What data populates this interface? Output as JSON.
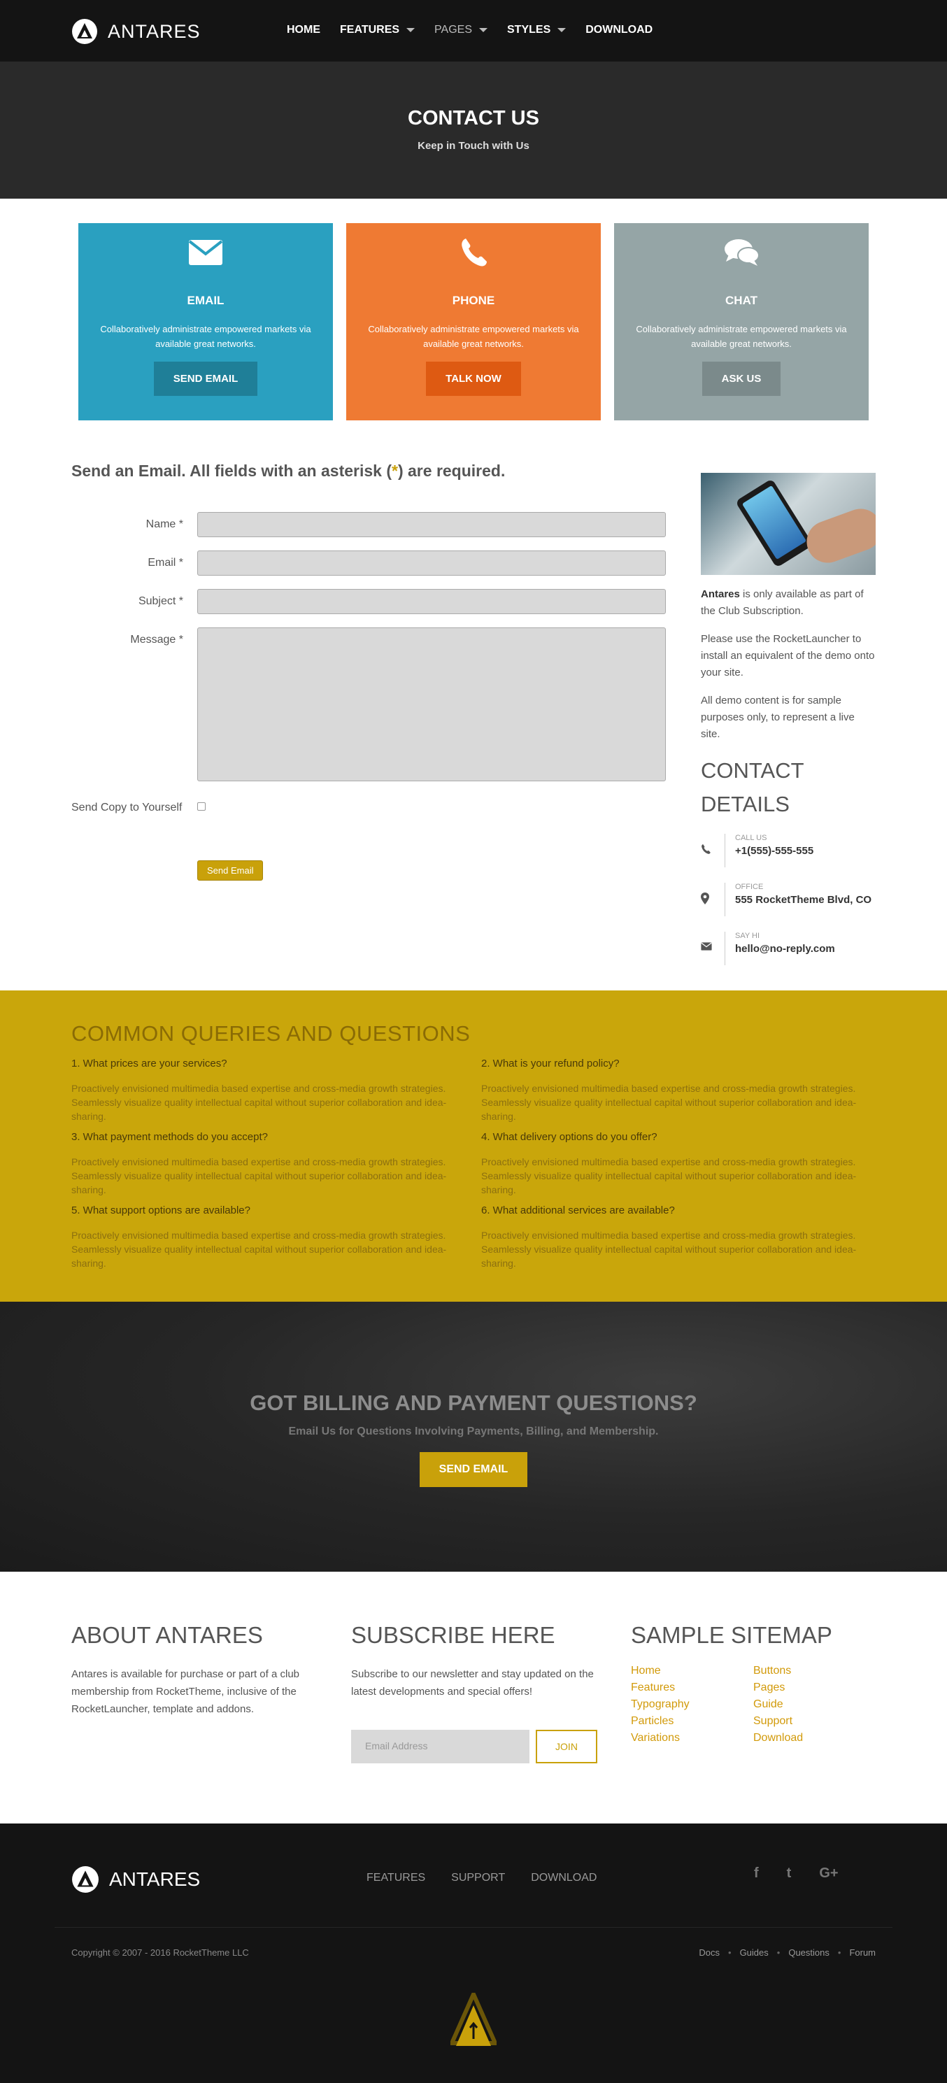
{
  "header": {
    "brand": "ANTARES",
    "nav": [
      {
        "label": "HOME",
        "dropdown": false
      },
      {
        "label": "FEATURES",
        "dropdown": true
      },
      {
        "label": "PAGES",
        "dropdown": true
      },
      {
        "label": "STYLES",
        "dropdown": true
      },
      {
        "label": "DOWNLOAD",
        "dropdown": false
      }
    ]
  },
  "title": {
    "heading": "CONTACT US",
    "subheading": "Keep in Touch with Us"
  },
  "cards": [
    {
      "icon": "envelope-icon",
      "title": "EMAIL",
      "text": "Collaboratively administrate empowered markets via available great networks.",
      "button": "SEND EMAIL",
      "color": "#2aa0c0",
      "button_color": "#1f7f98"
    },
    {
      "icon": "phone-icon",
      "title": "PHONE",
      "text": "Collaboratively administrate empowered markets via available great networks.",
      "button": "TALK NOW",
      "color": "#ef7a33",
      "button_color": "#de5a12"
    },
    {
      "icon": "chat-icon",
      "title": "CHAT",
      "text": "Collaboratively administrate empowered markets via available great networks.",
      "button": "ASK US",
      "color": "#95a5a6",
      "button_color": "#7b8a8b"
    }
  ],
  "form": {
    "heading_pre": "Send an Email. All fields with an asterisk (",
    "heading_star": "*",
    "heading_post": ") are required.",
    "name_label": "Name *",
    "email_label": "Email *",
    "subject_label": "Subject *",
    "message_label": "Message *",
    "copy_label": "Send Copy to Yourself",
    "submit": "Send Email"
  },
  "aside": {
    "brand": "Antares",
    "p1_rest": " is only available as part of the Club Subscription.",
    "p2": "Please use the RocketLauncher to install an equivalent of the demo onto your site.",
    "p3": "All demo content is for sample purposes only, to represent a live site.",
    "contact_title": "CONTACT DETAILS",
    "details": [
      {
        "icon": "phone-icon",
        "label": "CALL US",
        "value": "+1(555)-555-555"
      },
      {
        "icon": "map-pin-icon",
        "label": "OFFICE",
        "value": "555 RocketTheme Blvd, CO"
      },
      {
        "icon": "envelope-icon",
        "label": "SAY HI",
        "value": "hello@no-reply.com"
      }
    ]
  },
  "faq": {
    "title": "COMMON QUERIES AND QUESTIONS",
    "items": [
      {
        "q": "1. What prices are your services?",
        "a": "Proactively envisioned multimedia based expertise and cross-media growth strategies. Seamlessly visualize quality intellectual capital without superior collaboration and idea-sharing."
      },
      {
        "q": "2. What is your refund policy?",
        "a": "Proactively envisioned multimedia based expertise and cross-media growth strategies. Seamlessly visualize quality intellectual capital without superior collaboration and idea-sharing."
      },
      {
        "q": "3. What payment methods do you accept?",
        "a": "Proactively envisioned multimedia based expertise and cross-media growth strategies. Seamlessly visualize quality intellectual capital without superior collaboration and idea-sharing."
      },
      {
        "q": "4. What delivery options do you offer?",
        "a": "Proactively envisioned multimedia based expertise and cross-media growth strategies. Seamlessly visualize quality intellectual capital without superior collaboration and idea-sharing."
      },
      {
        "q": "5. What support options are available?",
        "a": "Proactively envisioned multimedia based expertise and cross-media growth strategies. Seamlessly visualize quality intellectual capital without superior collaboration and idea-sharing."
      },
      {
        "q": "6. What additional services are available?",
        "a": "Proactively envisioned multimedia based expertise and cross-media growth strategies. Seamlessly visualize quality intellectual capital without superior collaboration and idea-sharing."
      }
    ]
  },
  "billing": {
    "title": "GOT BILLING AND PAYMENT QUESTIONS?",
    "subtitle": "Email Us for Questions Involving Payments, Billing, and Membership.",
    "button": "SEND EMAIL"
  },
  "about": {
    "title": "ABOUT ANTARES",
    "text": "Antares is available for purchase or part of a club membership from RocketTheme, inclusive of the RocketLauncher, template and addons."
  },
  "subscribe": {
    "title": "SUBSCRIBE HERE",
    "text": "Subscribe to our newsletter and stay updated on the latest developments and special offers!",
    "placeholder": "Email Address",
    "button": "JOIN"
  },
  "sitemap": {
    "title": "SAMPLE SITEMAP",
    "links": [
      "Home",
      "Buttons",
      "Features",
      "Pages",
      "Typography",
      "Guide",
      "Particles",
      "Support",
      "Variations",
      "Download"
    ]
  },
  "footer": {
    "brand": "ANTARES",
    "nav": [
      "FEATURES",
      "SUPPORT",
      "DOWNLOAD"
    ],
    "social": [
      "facebook-icon",
      "twitter-icon",
      "google-plus-icon"
    ],
    "social_glyphs": [
      "f",
      "t",
      "G+"
    ],
    "copyright": "Copyright © 2007 - 2016 RocketTheme LLC",
    "links": [
      "Docs",
      "Guides",
      "Questions",
      "Forum"
    ]
  },
  "colors": {
    "accent": "#c9a10a",
    "dark": "#141414"
  }
}
